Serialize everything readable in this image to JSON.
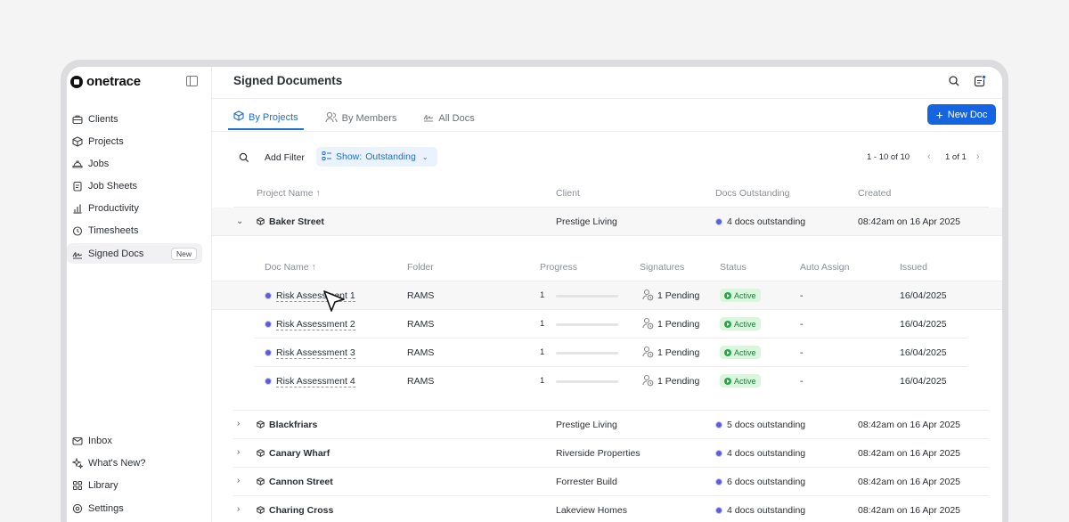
{
  "app": {
    "logo_text": "onetrace"
  },
  "sidebar": {
    "items": [
      {
        "label": "Clients",
        "icon": "briefcase-icon"
      },
      {
        "label": "Projects",
        "icon": "cube-icon"
      },
      {
        "label": "Jobs",
        "icon": "hardhat-icon"
      },
      {
        "label": "Job Sheets",
        "icon": "clipboard-icon"
      },
      {
        "label": "Productivity",
        "icon": "bar-chart-icon"
      },
      {
        "label": "Timesheets",
        "icon": "clock-icon"
      },
      {
        "label": "Signed Docs",
        "icon": "signature-icon",
        "badge": "New",
        "active": true
      }
    ],
    "bottom_items": [
      {
        "label": "Inbox",
        "icon": "inbox-icon"
      },
      {
        "label": "What's New?",
        "icon": "sparkle-icon"
      },
      {
        "label": "Library",
        "icon": "library-icon"
      },
      {
        "label": "Settings",
        "icon": "gear-icon"
      }
    ]
  },
  "header": {
    "title": "Signed Documents"
  },
  "tabs": [
    {
      "label": "By Projects",
      "icon": "cube-icon",
      "active": true
    },
    {
      "label": "By Members",
      "icon": "members-icon",
      "active": false
    },
    {
      "label": "All Docs",
      "icon": "signature-icon",
      "active": false
    }
  ],
  "toolbar": {
    "new_doc_label": "New Doc"
  },
  "filters": {
    "add_filter_label": "Add Filter",
    "show_prefix": "Show:",
    "show_value": "Outstanding"
  },
  "pagination": {
    "range": "1 - 10 of 10",
    "page": "1 of 1"
  },
  "table": {
    "columns": [
      "Project Name ↑",
      "Client",
      "Docs Outstanding",
      "Created"
    ],
    "expanded": {
      "project": "Baker Street",
      "client": "Prestige Living",
      "docs": "4 docs outstanding",
      "created": "08:42am on 16 Apr 2025",
      "sub_columns": [
        "Doc Name ↑",
        "Folder",
        "Progress",
        "Signatures",
        "Status",
        "Auto Assign",
        "Issued"
      ],
      "docs_rows": [
        {
          "name": "Risk Assessment 1",
          "folder": "RAMS",
          "progress": "1",
          "progress_fraction": 0,
          "signatures": "1 Pending",
          "status": "Active",
          "auto_assign": "-",
          "issued": "16/04/2025"
        },
        {
          "name": "Risk Assessment 2",
          "folder": "RAMS",
          "progress": "1",
          "progress_fraction": 0,
          "signatures": "1 Pending",
          "status": "Active",
          "auto_assign": "-",
          "issued": "16/04/2025"
        },
        {
          "name": "Risk Assessment 3",
          "folder": "RAMS",
          "progress": "1",
          "progress_fraction": 0,
          "signatures": "1 Pending",
          "status": "Active",
          "auto_assign": "-",
          "issued": "16/04/2025"
        },
        {
          "name": "Risk Assessment 4",
          "folder": "RAMS",
          "progress": "1",
          "progress_fraction": 0,
          "signatures": "1 Pending",
          "status": "Active",
          "auto_assign": "-",
          "issued": "16/04/2025"
        }
      ]
    },
    "rows": [
      {
        "project": "Blackfriars",
        "client": "Prestige Living",
        "docs": "5 docs outstanding",
        "created": "08:42am on 16 Apr 2025"
      },
      {
        "project": "Canary Wharf",
        "client": "Riverside Properties",
        "docs": "4 docs outstanding",
        "created": "08:42am on 16 Apr 2025"
      },
      {
        "project": "Cannon Street",
        "client": "Forrester Build",
        "docs": "6 docs outstanding",
        "created": "08:42am on 16 Apr 2025"
      },
      {
        "project": "Charing Cross",
        "client": "Lakeview Homes",
        "docs": "4 docs outstanding",
        "created": "08:42am on 16 Apr 2025"
      }
    ]
  },
  "colors": {
    "accent": "#1565e0",
    "status_active_bg": "#dcf5df",
    "status_active_text": "#1a7f37"
  }
}
